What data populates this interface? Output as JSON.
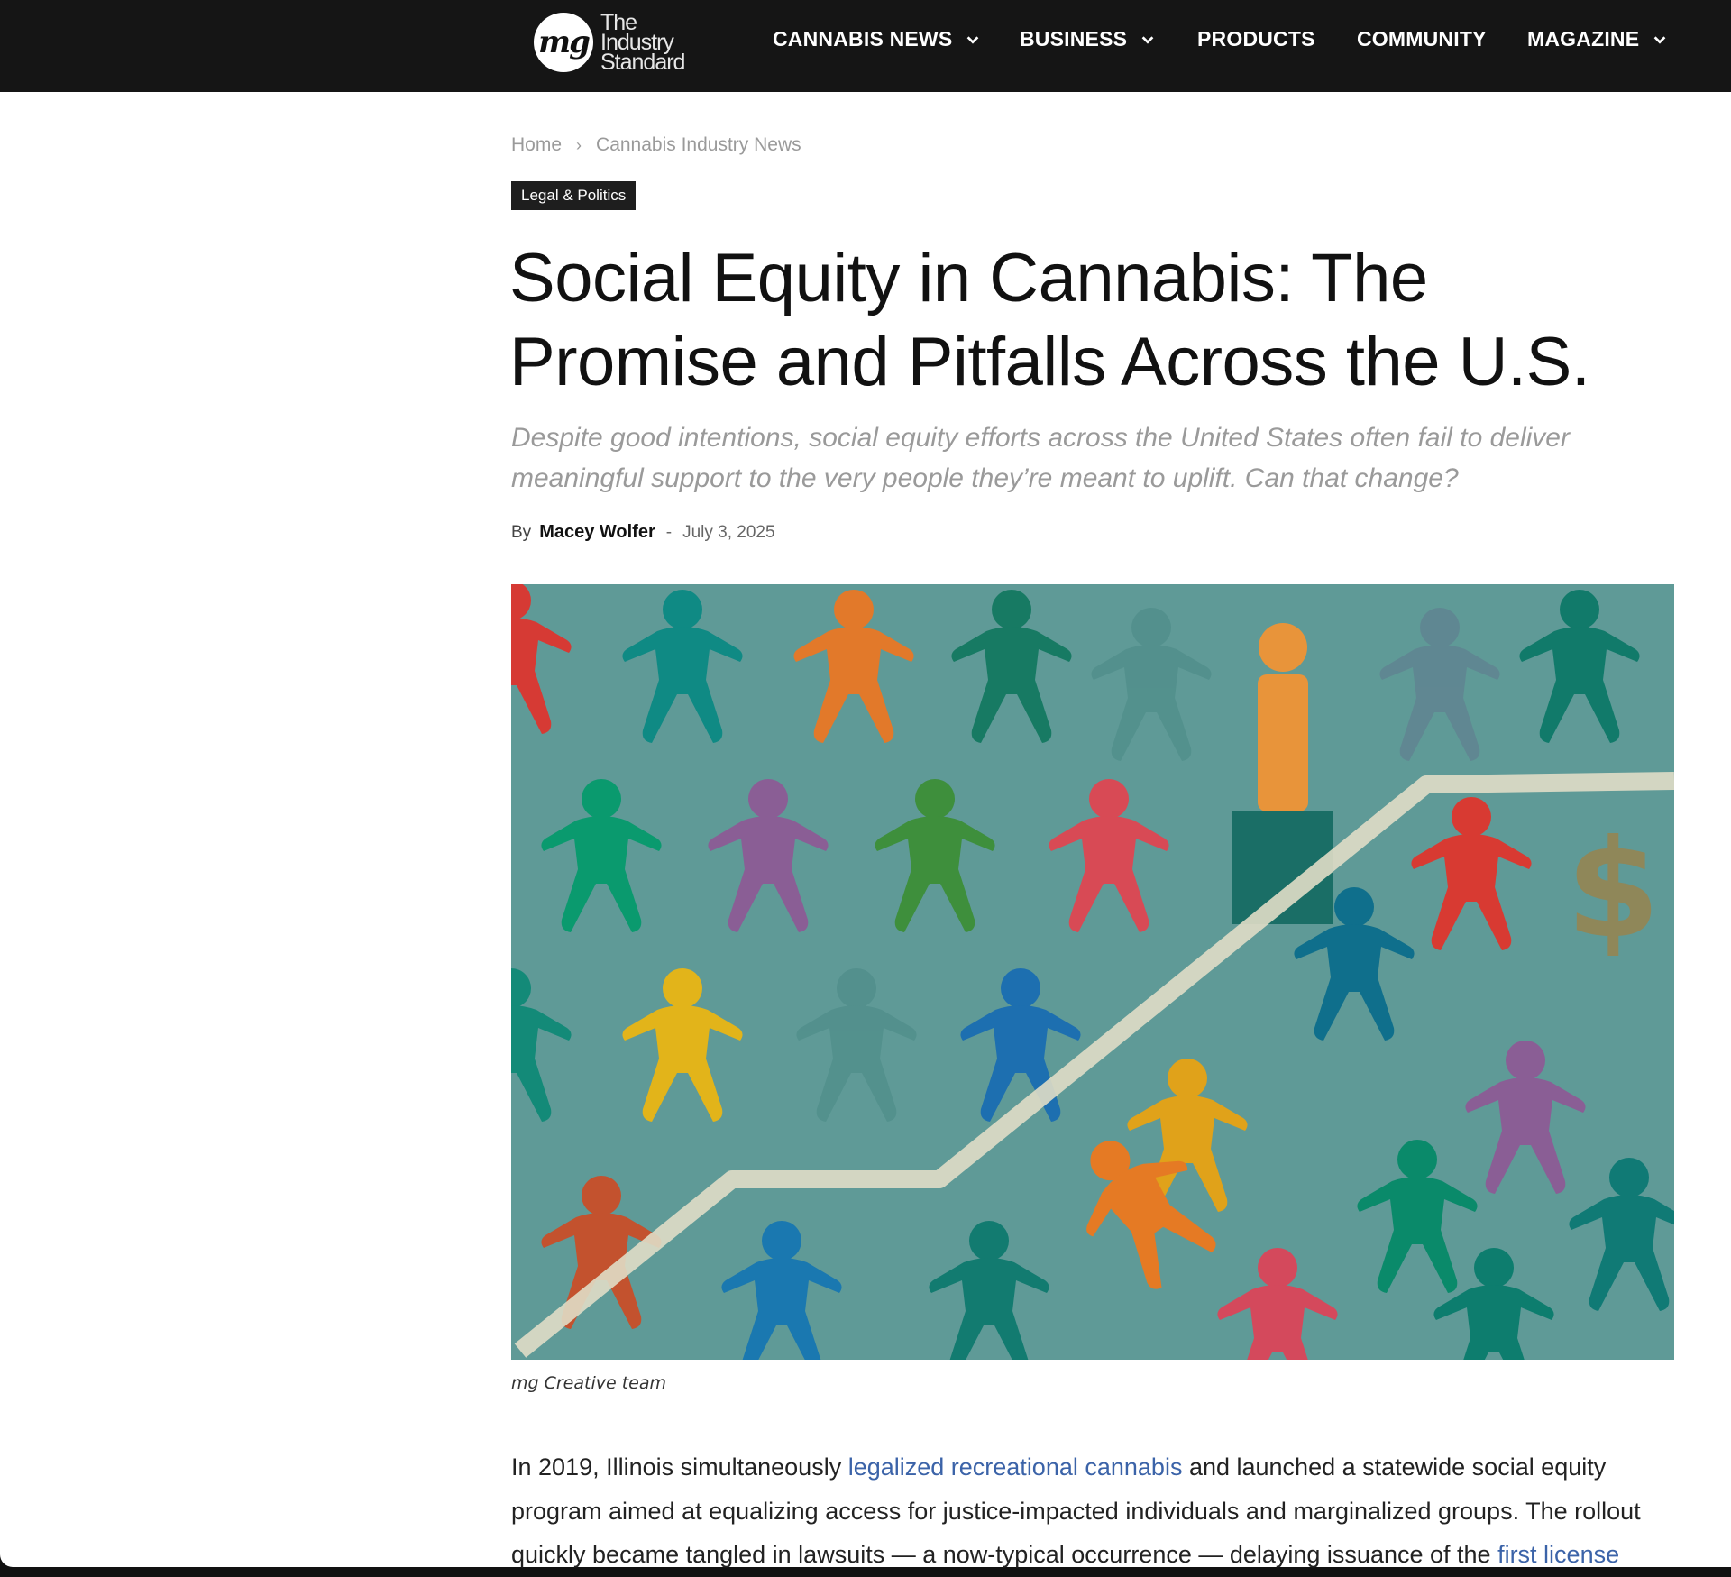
{
  "brand": {
    "logo_mark": "mg",
    "logo_line1": "The",
    "logo_line2": "Industry",
    "logo_line3": "Standard"
  },
  "nav": [
    {
      "label": "CANNABIS NEWS",
      "has_dropdown": true
    },
    {
      "label": "BUSINESS",
      "has_dropdown": true
    },
    {
      "label": "PRODUCTS",
      "has_dropdown": false
    },
    {
      "label": "COMMUNITY",
      "has_dropdown": false
    },
    {
      "label": "MAGAZINE",
      "has_dropdown": true
    }
  ],
  "breadcrumb": {
    "home": "Home",
    "separator": "›",
    "section": "Cannabis Industry News"
  },
  "category_tag": "Legal & Politics",
  "article": {
    "title_line1": "Social Equity in Cannabis: The",
    "title_line2": "Promise and Pitfalls Across the U.S.",
    "subtitle": "Despite good intentions, social equity efforts across the United States often fail to deliver meaningful support to the very people they’re meant to uplift. Can that change?",
    "by_label": "By",
    "author": "Macey Wolfer",
    "dash": "-",
    "date": "July 3, 2025",
    "image_caption": "mg Creative team",
    "body": {
      "p1_a": "In 2019, Illinois simultaneously ",
      "p1_link1": "legalized recreational cannabis",
      "p1_b": " and launched a statewide social equity program aimed at equalizing access for justice-impacted individuals and marginalized groups. The rollout quickly became tangled in lawsuits — a now-typical occurrence — delaying issuance of the ",
      "p1_link2": "first license"
    }
  },
  "colors": {
    "nav_bg": "#151515",
    "link": "#3b63a8",
    "image_bg": "#5f9a97",
    "tag_bg": "#1e1e1e"
  }
}
